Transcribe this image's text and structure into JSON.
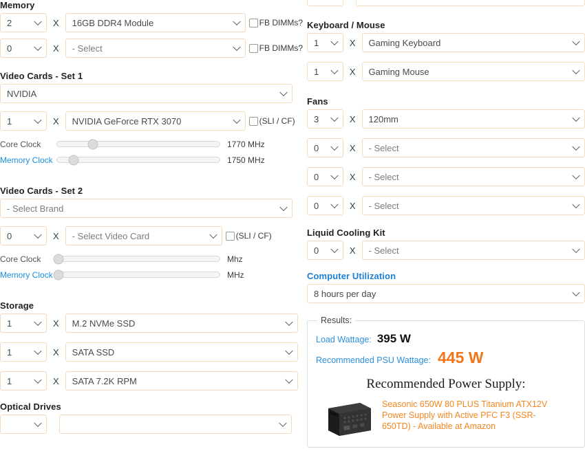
{
  "left": {
    "memory": {
      "title": "Memory",
      "rows": [
        {
          "qty": "2",
          "x": "X",
          "item": "16GB DDR4 Module",
          "placeholder": false,
          "checkbox_label": "FB DIMMs?",
          "checked": false
        },
        {
          "qty": "0",
          "x": "X",
          "item": "- Select",
          "placeholder": true,
          "checkbox_label": "FB DIMMs?",
          "checked": false
        }
      ]
    },
    "video_set1": {
      "title": "Video Cards - Set 1",
      "brand": "NVIDIA",
      "brand_placeholder": false,
      "row": {
        "qty": "1",
        "x": "X",
        "item": "NVIDIA GeForce RTX 3070",
        "placeholder": false,
        "checkbox_label": "(SLI / CF)",
        "checked": false
      },
      "sliders": [
        {
          "label": "Core Clock",
          "label_style": "gray",
          "value": "1770 MHz",
          "percent": 22
        },
        {
          "label": "Memory Clock",
          "label_style": "blue",
          "value": "1750 MHz",
          "percent": 10
        }
      ]
    },
    "video_set2": {
      "title": "Video Cards - Set 2",
      "brand": "- Select Brand",
      "brand_placeholder": true,
      "row": {
        "qty": "0",
        "x": "X",
        "item": "- Select Video Card",
        "placeholder": true,
        "checkbox_label": "(SLI / CF)",
        "checked": false
      },
      "sliders": [
        {
          "label": "Core Clock",
          "label_style": "gray",
          "value": "Mhz",
          "percent": 1
        },
        {
          "label": "Memory Clock",
          "label_style": "blue",
          "value": "MHz",
          "percent": 1
        }
      ]
    },
    "storage": {
      "title": "Storage",
      "rows": [
        {
          "qty": "1",
          "x": "X",
          "item": "M.2 NVMe SSD",
          "placeholder": false
        },
        {
          "qty": "1",
          "x": "X",
          "item": "SATA SSD",
          "placeholder": false
        },
        {
          "qty": "1",
          "x": "X",
          "item": "SATA 7.2K RPM",
          "placeholder": false
        }
      ]
    },
    "optical": {
      "title": "Optical Drives"
    }
  },
  "right": {
    "keyboard_mouse": {
      "title": "Keyboard / Mouse",
      "rows": [
        {
          "qty": "1",
          "x": "X",
          "item": "Gaming Keyboard",
          "placeholder": false
        },
        {
          "qty": "1",
          "x": "X",
          "item": "Gaming Mouse",
          "placeholder": false
        }
      ]
    },
    "fans": {
      "title": "Fans",
      "rows": [
        {
          "qty": "3",
          "x": "X",
          "item": "120mm",
          "placeholder": false
        },
        {
          "qty": "0",
          "x": "X",
          "item": "- Select",
          "placeholder": true
        },
        {
          "qty": "0",
          "x": "X",
          "item": "- Select",
          "placeholder": true
        },
        {
          "qty": "0",
          "x": "X",
          "item": "- Select",
          "placeholder": true
        }
      ]
    },
    "liquid_cooling": {
      "title": "Liquid Cooling Kit",
      "row": {
        "qty": "0",
        "x": "X",
        "item": "- Select",
        "placeholder": true
      }
    },
    "utilization": {
      "title": "Computer Utilization",
      "value": "8 hours per day"
    },
    "results": {
      "legend": "Results:",
      "load_key": "Load Wattage:",
      "load_value": "395 W",
      "psu_key": "Recommended PSU Wattage:",
      "psu_value": "445 W",
      "recommended_title": "Recommended Power Supply:",
      "product_link": "Seasonic 650W 80 PLUS Titanium ATX12V Power Supply with Active PFC F3 (SSR-650TD) - Available at Amazon",
      "product_image_name": "power-supply-thumbnail"
    }
  },
  "colors": {
    "field_border": "#f6d9bb",
    "link_blue": "#1a7fd4",
    "accent_orange": "#f3751a",
    "product_orange": "#f3861f"
  }
}
